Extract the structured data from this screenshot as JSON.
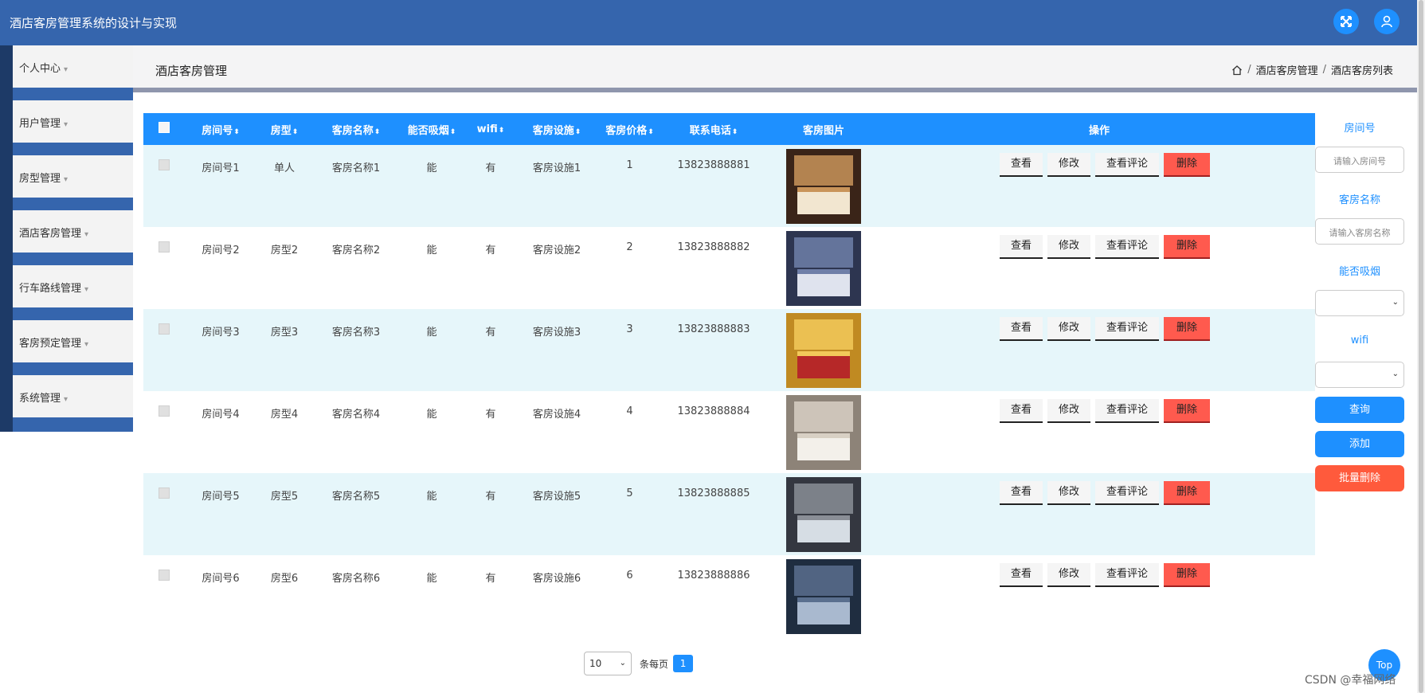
{
  "app_title": "酒店客房管理系统的设计与实现",
  "header_icons": [
    "fullscreen-icon",
    "user-icon"
  ],
  "sidebar": {
    "items": [
      {
        "label": "个人中心"
      },
      {
        "label": "用户管理"
      },
      {
        "label": "房型管理"
      },
      {
        "label": "酒店客房管理"
      },
      {
        "label": "行车路线管理"
      },
      {
        "label": "客房预定管理"
      },
      {
        "label": "系统管理"
      }
    ]
  },
  "page": {
    "title": "酒店客房管理",
    "breadcrumb": [
      "酒店客房管理",
      "酒店客房列表"
    ]
  },
  "table": {
    "columns": [
      "房间号",
      "房型",
      "客房名称",
      "能否吸烟",
      "wifi",
      "客房设施",
      "客房价格",
      "联系电话",
      "客房图片",
      "操作"
    ],
    "actions": {
      "view": "查看",
      "edit": "修改",
      "comments": "查看评论",
      "delete": "删除"
    },
    "rows": [
      {
        "room_no": "房间号1",
        "type": "单人",
        "name": "客房名称1",
        "smoking": "能",
        "wifi": "有",
        "facility": "客房设施1",
        "price": "1",
        "phone": "13823888881"
      },
      {
        "room_no": "房间号2",
        "type": "房型2",
        "name": "客房名称2",
        "smoking": "能",
        "wifi": "有",
        "facility": "客房设施2",
        "price": "2",
        "phone": "13823888882"
      },
      {
        "room_no": "房间号3",
        "type": "房型3",
        "name": "客房名称3",
        "smoking": "能",
        "wifi": "有",
        "facility": "客房设施3",
        "price": "3",
        "phone": "13823888883"
      },
      {
        "room_no": "房间号4",
        "type": "房型4",
        "name": "客房名称4",
        "smoking": "能",
        "wifi": "有",
        "facility": "客房设施4",
        "price": "4",
        "phone": "13823888884"
      },
      {
        "room_no": "房间号5",
        "type": "房型5",
        "name": "客房名称5",
        "smoking": "能",
        "wifi": "有",
        "facility": "客房设施5",
        "price": "5",
        "phone": "13823888885"
      },
      {
        "room_no": "房间号6",
        "type": "房型6",
        "name": "客房名称6",
        "smoking": "能",
        "wifi": "有",
        "facility": "客房设施6",
        "price": "6",
        "phone": "13823888886"
      }
    ]
  },
  "search": {
    "room_no_label": "房间号",
    "room_no_placeholder": "请输入房间号",
    "room_name_label": "客房名称",
    "room_name_placeholder": "请输入客房名称",
    "smoking_label": "能否吸烟",
    "wifi_label": "wifi",
    "query_button": "查询",
    "add_button": "添加",
    "batch_delete_button": "批量删除"
  },
  "pagination": {
    "page_size": "10",
    "per_page_label": "条每页",
    "current_page": "1"
  },
  "top_button": "Top",
  "watermark": "CSDN @幸福网络",
  "colors": {
    "header": "#3565ad",
    "accent": "#1e90ff",
    "danger": "#ff5a4e",
    "row_alt": "#e6f6fa"
  }
}
